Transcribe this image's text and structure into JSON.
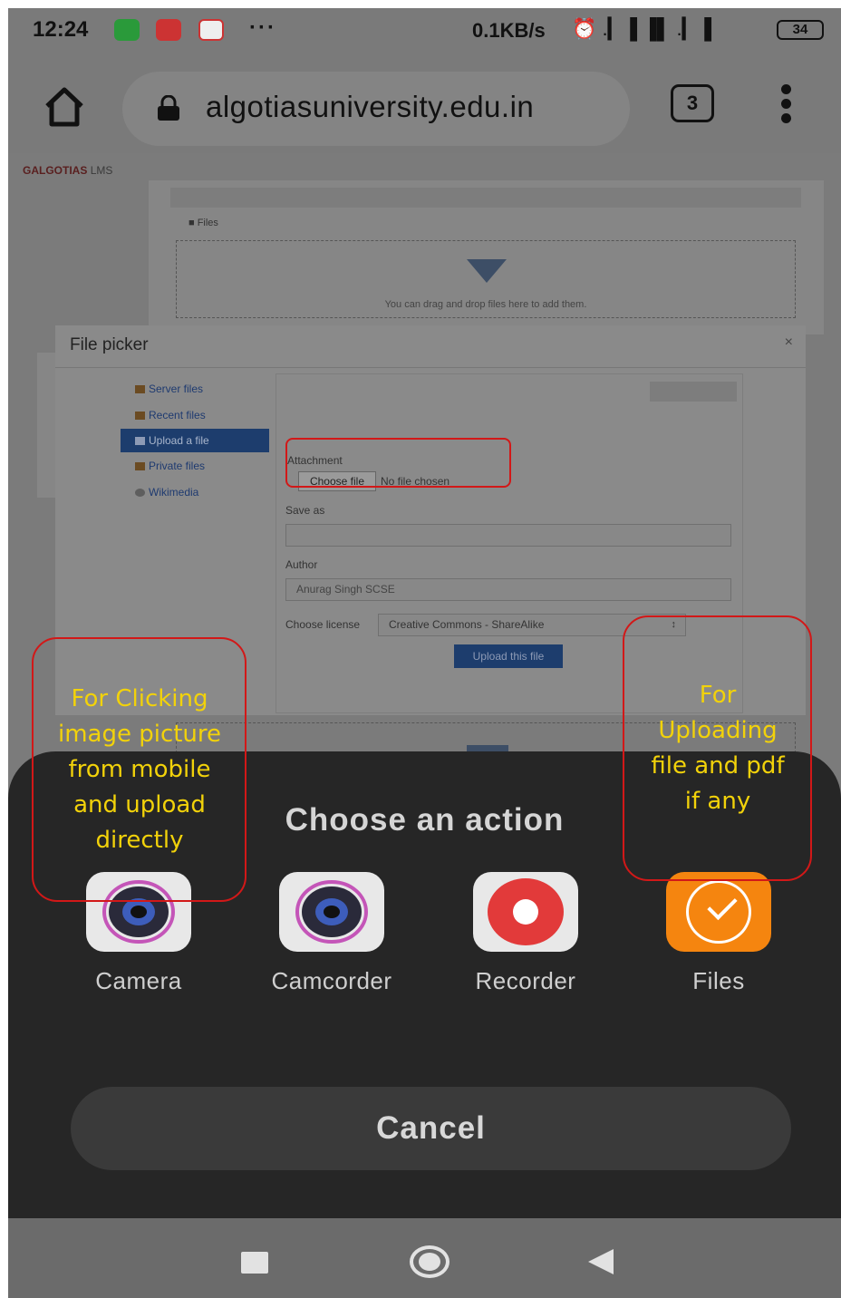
{
  "status_bar": {
    "time": "12:24",
    "overflow": "···",
    "net_speed": "0.1KB/s",
    "indicators": "⏰ .▎▐ ▐▌ .▎▐",
    "battery": "34",
    "apps": [
      "whatsapp-icon",
      "chrome-icon",
      "gmail-icon"
    ]
  },
  "browser": {
    "url": "algotiasuniversity.edu.in",
    "tab_count": "3"
  },
  "lms": {
    "logo_brand": "GALGOTIAS",
    "logo_suffix": "LMS",
    "files_label": "Files",
    "drop_hint": "You can drag and drop files here to add them."
  },
  "file_picker": {
    "title": "File picker",
    "close": "×",
    "repositories": [
      {
        "label": "Server files"
      },
      {
        "label": "Recent files"
      },
      {
        "label": "Upload a file",
        "active": true
      },
      {
        "label": "Private files"
      },
      {
        "label": "Wikimedia"
      }
    ],
    "attachment_label": "Attachment",
    "choose_file_button": "Choose file",
    "no_file_text": "No file chosen",
    "save_as_label": "Save as",
    "save_as_value": "",
    "author_label": "Author",
    "author_value": "Anurag Singh SCSE",
    "license_label": "Choose license",
    "license_value": "Creative Commons - ShareAlike",
    "upload_button": "Upload this file"
  },
  "action_sheet": {
    "title": "Choose an action",
    "actions": [
      {
        "label": "Camera",
        "icon": "camera-icon"
      },
      {
        "label": "Camcorder",
        "icon": "camcorder-icon"
      },
      {
        "label": "Recorder",
        "icon": "recorder-icon"
      },
      {
        "label": "Files",
        "icon": "files-icon"
      }
    ],
    "cancel": "Cancel"
  },
  "annotations": {
    "left": "For Clicking image picture from mobile and upload directly",
    "right": "For Uploading file and pdf if any",
    "color": "#d21818",
    "text_color": "#f2d20a"
  }
}
